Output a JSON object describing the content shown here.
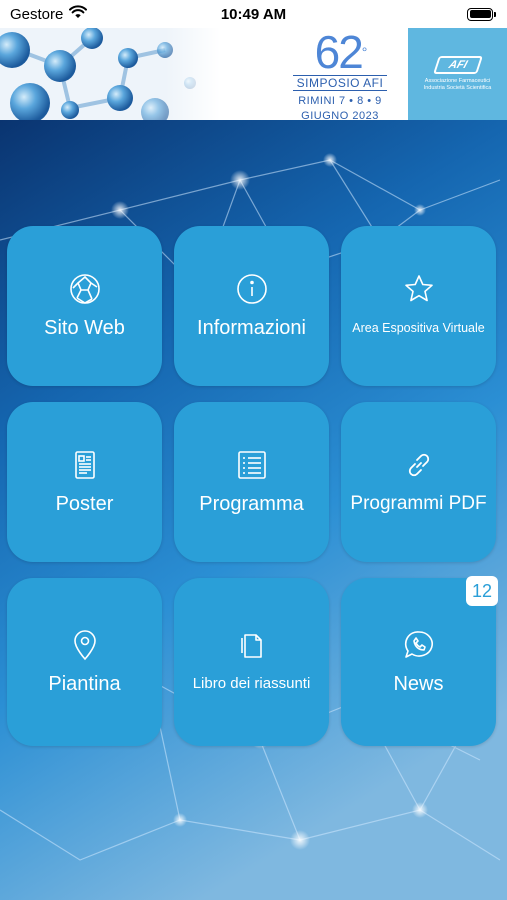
{
  "status_bar": {
    "carrier": "Gestore",
    "time": "10:49 AM"
  },
  "banner": {
    "event_number": "62",
    "event_number_suffix": "°",
    "event_name": "SIMPOSIO AFI",
    "event_place": "RIMINI 7 • 8 • 9",
    "event_date": "GIUGNO 2023",
    "logo_abbr": "AFI",
    "logo_text": "Associazione Farmaceutici Industria Società Scientifica"
  },
  "tiles": [
    {
      "label": "Sito Web",
      "icon": "globe-icon"
    },
    {
      "label": "Informazioni",
      "icon": "info-icon"
    },
    {
      "label": "Area Espositiva Virtuale",
      "icon": "star-icon"
    },
    {
      "label": "Poster",
      "icon": "document-icon"
    },
    {
      "label": "Programma",
      "icon": "list-icon"
    },
    {
      "label": "Programmi PDF",
      "icon": "link-icon"
    },
    {
      "label": "Piantina",
      "icon": "map-pin-icon"
    },
    {
      "label": "Libro dei riassunti",
      "icon": "files-icon"
    },
    {
      "label": "News",
      "icon": "chat-icon",
      "badge": "12"
    }
  ],
  "colors": {
    "tile": "#2a9fd8",
    "background": "#0d3f78",
    "logo_bg": "#5fb7e0"
  }
}
